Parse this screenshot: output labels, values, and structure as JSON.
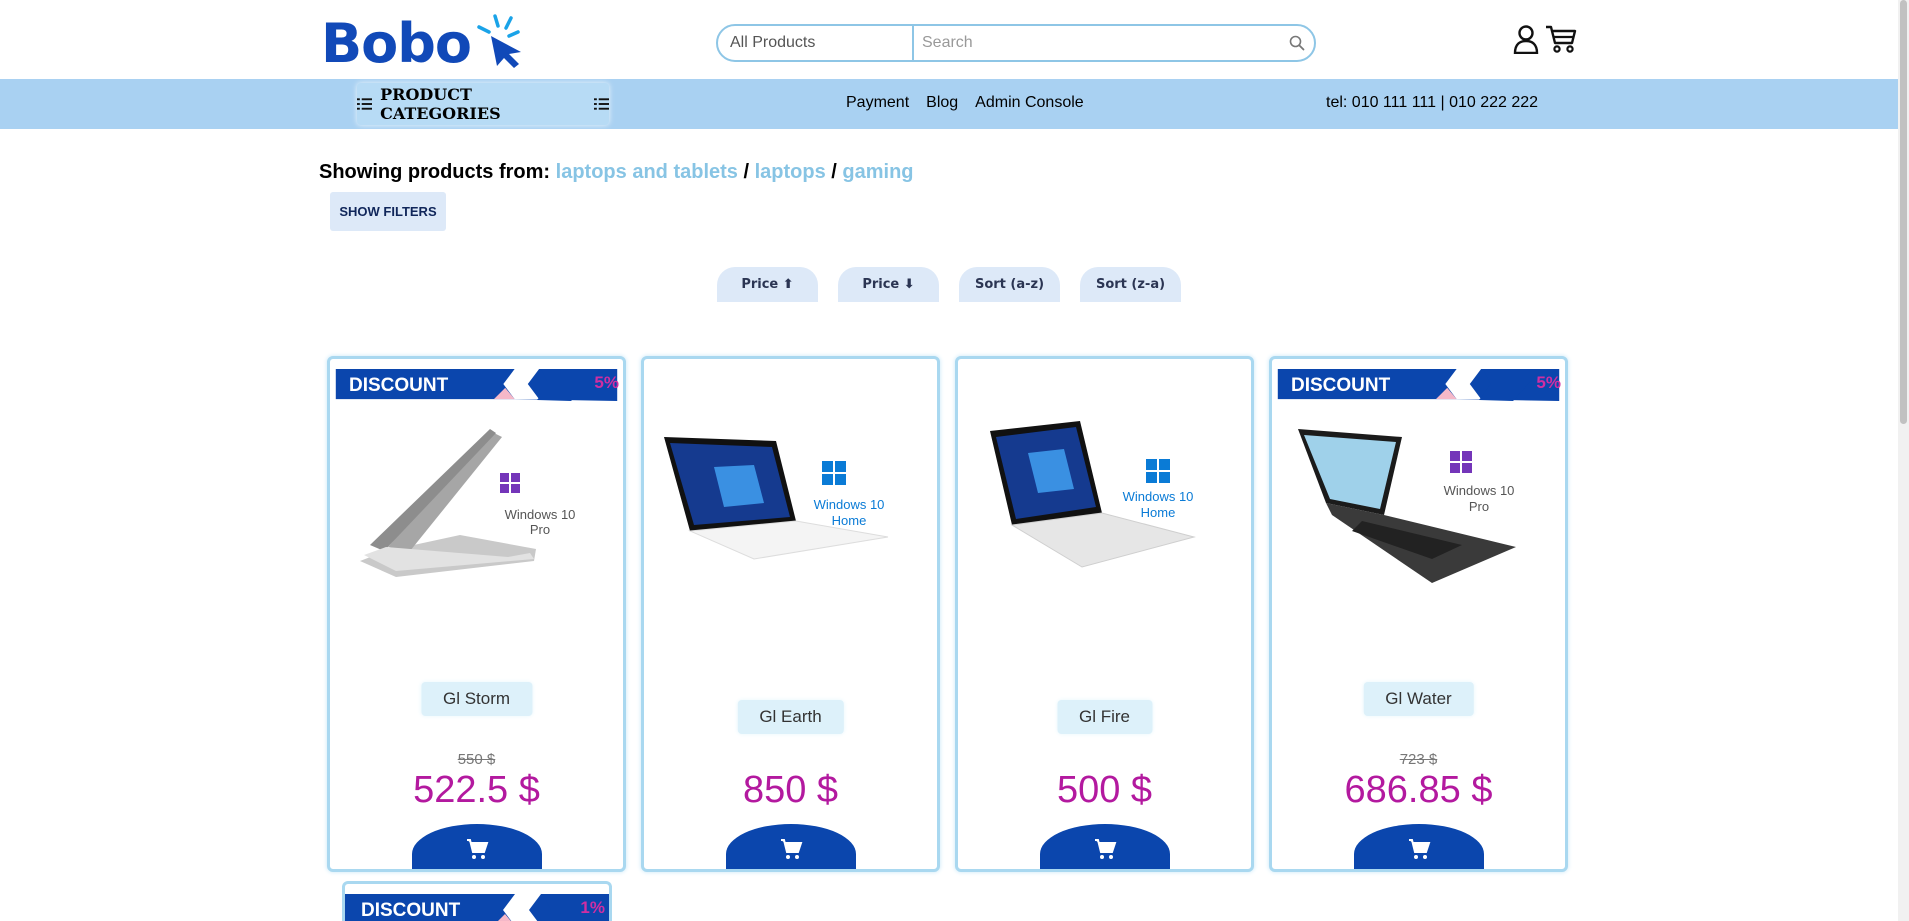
{
  "brand": {
    "name": "Bobo",
    "color": "#1149b8"
  },
  "search": {
    "category": "All Products",
    "placeholder": "Search"
  },
  "nav": {
    "categories_label": "PRODUCT CATEGORIES",
    "links": [
      "Payment",
      "Blog",
      "Admin Console"
    ],
    "phone": "tel: 010 111 111 | 010 222 222"
  },
  "breadcrumb": {
    "prefix": "Showing products from:",
    "items": [
      "laptops and tablets",
      "laptops",
      "gaming"
    ]
  },
  "filters": {
    "show_label": "SHOW FILTERS"
  },
  "sort": [
    "Price ⬆",
    "Price ⬇",
    "Sort (a-z)",
    "Sort (z-a)"
  ],
  "products": [
    {
      "name": "Gl Storm",
      "discount_label": "DISCOUNT",
      "discount": "5%",
      "old_price": "550 $",
      "price": "522.5 $",
      "os": [
        "Windows 10",
        "Pro"
      ]
    },
    {
      "name": "Gl Earth",
      "price": "850 $",
      "os": [
        "Windows 10",
        "Home"
      ]
    },
    {
      "name": "Gl Fire",
      "price": "500 $",
      "os": [
        "Windows 10",
        "Home"
      ]
    },
    {
      "name": "Gl Water",
      "discount_label": "DISCOUNT",
      "discount": "5%",
      "old_price": "723 $",
      "price": "686.85 $",
      "os": [
        "Windows 10",
        "Pro"
      ]
    }
  ],
  "partial_product": {
    "discount_label": "DISCOUNT",
    "discount": "1%"
  },
  "colors": {
    "accent": "#0b46ad",
    "nav_bg": "#a9d1f2",
    "price": "#b3199f",
    "crumb": "#87c4e4"
  }
}
